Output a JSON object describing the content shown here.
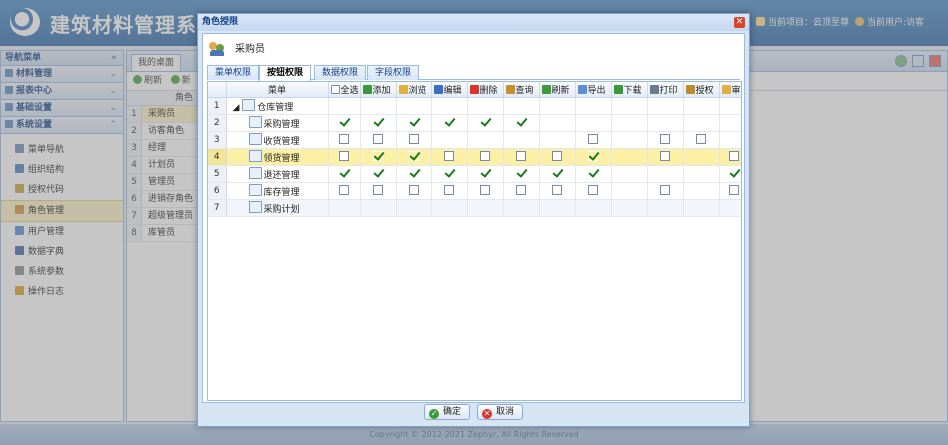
{
  "app": {
    "title": "建筑材料管理系统",
    "current_project": "当前项目：云顶至尊",
    "current_user": "当前用户:访客"
  },
  "nav": {
    "title": "导航菜单",
    "sections": [
      "材料管理",
      "报表中心",
      "基础设置",
      "系统设置"
    ],
    "items": [
      {
        "label": "菜单导航",
        "icon": "tree-icon",
        "color": "#6b8fbf"
      },
      {
        "label": "组织结构",
        "icon": "org-icon",
        "color": "#4f7fc0"
      },
      {
        "label": "授权代码",
        "icon": "key-icon",
        "color": "#c9a23b"
      },
      {
        "label": "角色管理",
        "icon": "users-icon",
        "color": "#d1923a",
        "selected": true
      },
      {
        "label": "用户管理",
        "icon": "user-icon",
        "color": "#4f8ad1"
      },
      {
        "label": "数据字典",
        "icon": "book-icon",
        "color": "#4567a8"
      },
      {
        "label": "系统参数",
        "icon": "wrench-icon",
        "color": "#8a8a8a"
      },
      {
        "label": "操作日志",
        "icon": "warning-icon",
        "color": "#e0a020"
      }
    ]
  },
  "main": {
    "tab": "我的桌面",
    "toolbar": {
      "refresh": "刷新",
      "add": "新"
    },
    "grid_header": "角色",
    "roles": [
      "采购员",
      "访客角色",
      "经理",
      "计划员",
      "管理员",
      "进销存角色",
      "超级管理员",
      "库管员"
    ]
  },
  "dialog": {
    "title": "角色授限",
    "role_name": "采购员",
    "tabs": [
      "菜单权限",
      "按钮权限",
      "数据权限",
      "字段权限"
    ],
    "active_tab": 1,
    "columns": [
      {
        "label": "菜单"
      },
      {
        "label": "全选",
        "icon": "checkbox-icon",
        "color": "#ffffff"
      },
      {
        "label": "添加",
        "icon": "add-icon",
        "color": "#3a9a3a"
      },
      {
        "label": "浏览",
        "icon": "folder-icon",
        "color": "#e0b040"
      },
      {
        "label": "编辑",
        "icon": "pencil-icon",
        "color": "#3b6fc4"
      },
      {
        "label": "删除",
        "icon": "delete-icon",
        "color": "#d9342a"
      },
      {
        "label": "查询",
        "icon": "search-icon",
        "color": "#c8902a"
      },
      {
        "label": "刷新",
        "icon": "refresh-icon",
        "color": "#3e9a3e"
      },
      {
        "label": "导出",
        "icon": "export-icon",
        "color": "#5a8fd0"
      },
      {
        "label": "下载",
        "icon": "download-icon",
        "color": "#3a9a3a"
      },
      {
        "label": "打印",
        "icon": "print-icon",
        "color": "#6a7a8a"
      },
      {
        "label": "授权",
        "icon": "key-icon",
        "color": "#c08a30"
      },
      {
        "label": "审",
        "icon": "approve-icon",
        "color": "#e0b040"
      }
    ],
    "rows": [
      {
        "num": "1",
        "menu": "仓库管理",
        "level": 0,
        "cells": [
          null,
          null,
          null,
          null,
          null,
          null,
          null,
          null,
          null,
          null,
          null,
          null
        ]
      },
      {
        "num": "2",
        "menu": "采购管理",
        "level": 1,
        "cells": [
          true,
          true,
          true,
          true,
          true,
          true,
          null,
          null,
          null,
          null,
          null,
          null
        ]
      },
      {
        "num": "3",
        "menu": "收货管理",
        "level": 1,
        "cells": [
          false,
          false,
          false,
          null,
          null,
          null,
          null,
          false,
          null,
          false,
          false,
          null
        ]
      },
      {
        "num": "4",
        "menu": "领货管理",
        "level": 1,
        "selected": true,
        "cells": [
          false,
          true,
          true,
          false,
          false,
          false,
          false,
          true,
          null,
          false,
          null,
          false
        ]
      },
      {
        "num": "5",
        "menu": "退还管理",
        "level": 1,
        "cells": [
          true,
          true,
          true,
          true,
          true,
          true,
          true,
          true,
          null,
          null,
          null,
          true
        ]
      },
      {
        "num": "6",
        "menu": "库存管理",
        "level": 1,
        "cells": [
          false,
          false,
          false,
          false,
          false,
          false,
          false,
          false,
          null,
          false,
          null,
          false
        ]
      },
      {
        "num": "7",
        "menu": "采购计划",
        "level": 1,
        "cells": [
          null,
          null,
          null,
          null,
          null,
          null,
          null,
          null,
          null,
          null,
          null,
          null
        ]
      }
    ],
    "ok_label": "确定",
    "cancel_label": "取消"
  },
  "footer": {
    "copyright": "Copyright © 2012-2021 Zephyr, All Rights Reserved"
  }
}
